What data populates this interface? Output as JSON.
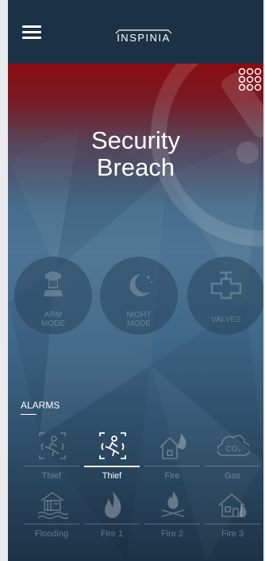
{
  "app": {
    "brand": "INSPINIA"
  },
  "hero": {
    "line1": "Security",
    "line2": "Breach"
  },
  "modes": [
    {
      "label1": "ARM",
      "label2": "MODE",
      "icon": "arm-icon"
    },
    {
      "label1": "NIGHT",
      "label2": "MODE",
      "icon": "moon-icon"
    },
    {
      "label1": "VALVES",
      "label2": "",
      "icon": "valve-icon"
    }
  ],
  "alarms": {
    "title": "ALARMS",
    "items": [
      {
        "label": "Thief",
        "icon": "thief-icon",
        "active": false
      },
      {
        "label": "Thief",
        "icon": "thief-icon",
        "active": true
      },
      {
        "label": "Fire",
        "icon": "house-fire-icon",
        "active": false
      },
      {
        "label": "Gas",
        "icon": "co2-cloud-icon",
        "active": false
      },
      {
        "label": "Flooding",
        "icon": "flooding-icon",
        "active": false
      },
      {
        "label": "Fire 1",
        "icon": "flame-icon",
        "active": false
      },
      {
        "label": "Fire 2",
        "icon": "campfire-icon",
        "active": false
      },
      {
        "label": "Fire 3",
        "icon": "house-burning-icon",
        "active": false
      }
    ]
  },
  "colors": {
    "alert_red": "#8a0c12",
    "topbar": "#1b3146"
  }
}
